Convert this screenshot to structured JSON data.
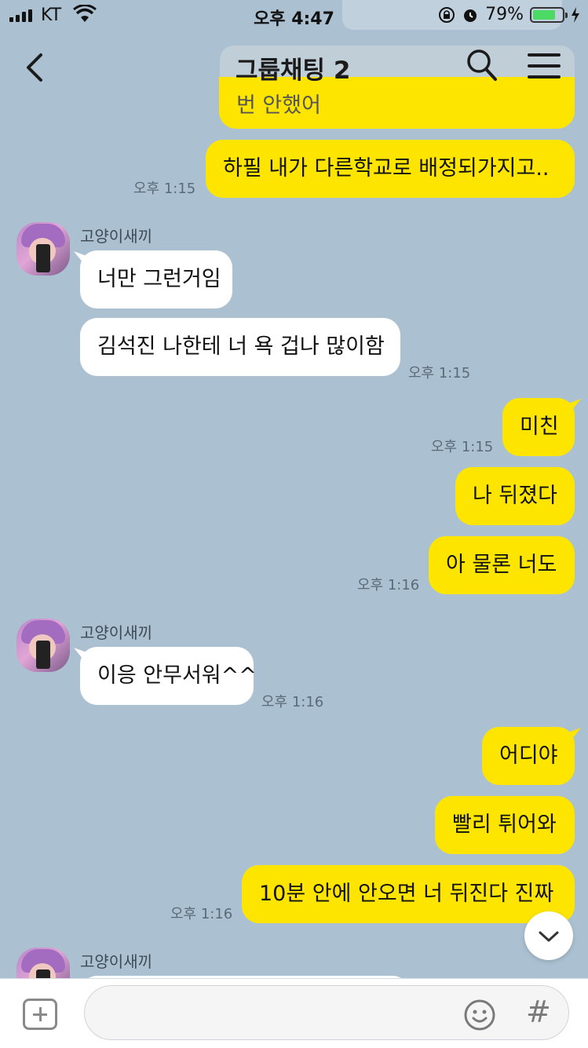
{
  "status_bar": {
    "carrier": "KT",
    "time": "오후 4:47",
    "battery": "79%",
    "battery_level": 0.79
  },
  "header": {
    "title": "그룹채팅 2"
  },
  "previous_message_partial": "번 안했어",
  "messages": [
    {
      "side": "me",
      "text": "하필 내가 다른학교로 배정되가지고..",
      "time": "오후 1:15"
    },
    {
      "side": "them",
      "sender": "고양이새끼",
      "text": "너만 그런거임"
    },
    {
      "side": "them",
      "text": "김석진 나한테 너 욕 겁나 많이함",
      "time": "오후 1:15"
    },
    {
      "side": "me",
      "text": "미친",
      "time": "오후 1:15"
    },
    {
      "side": "me",
      "text": "나 뒤졌다"
    },
    {
      "side": "me",
      "text": "아 물론 너도",
      "time": "오후 1:16"
    },
    {
      "side": "them",
      "sender": "고양이새끼",
      "text": "이응 안무서워^^",
      "time": "오후 1:16"
    },
    {
      "side": "me",
      "text": "어디야"
    },
    {
      "side": "me",
      "text": "빨리 튀어와"
    },
    {
      "side": "me",
      "text": "10분 안에 안오면 너 뒤진다 진짜",
      "time": "오후 1:16"
    },
    {
      "side": "them",
      "sender": "고양이새끼"
    }
  ],
  "icons": [
    "back-arrow-icon",
    "search-icon",
    "menu-icon",
    "plus-icon",
    "emoji-icon",
    "hash-icon",
    "chevron-down-icon"
  ]
}
